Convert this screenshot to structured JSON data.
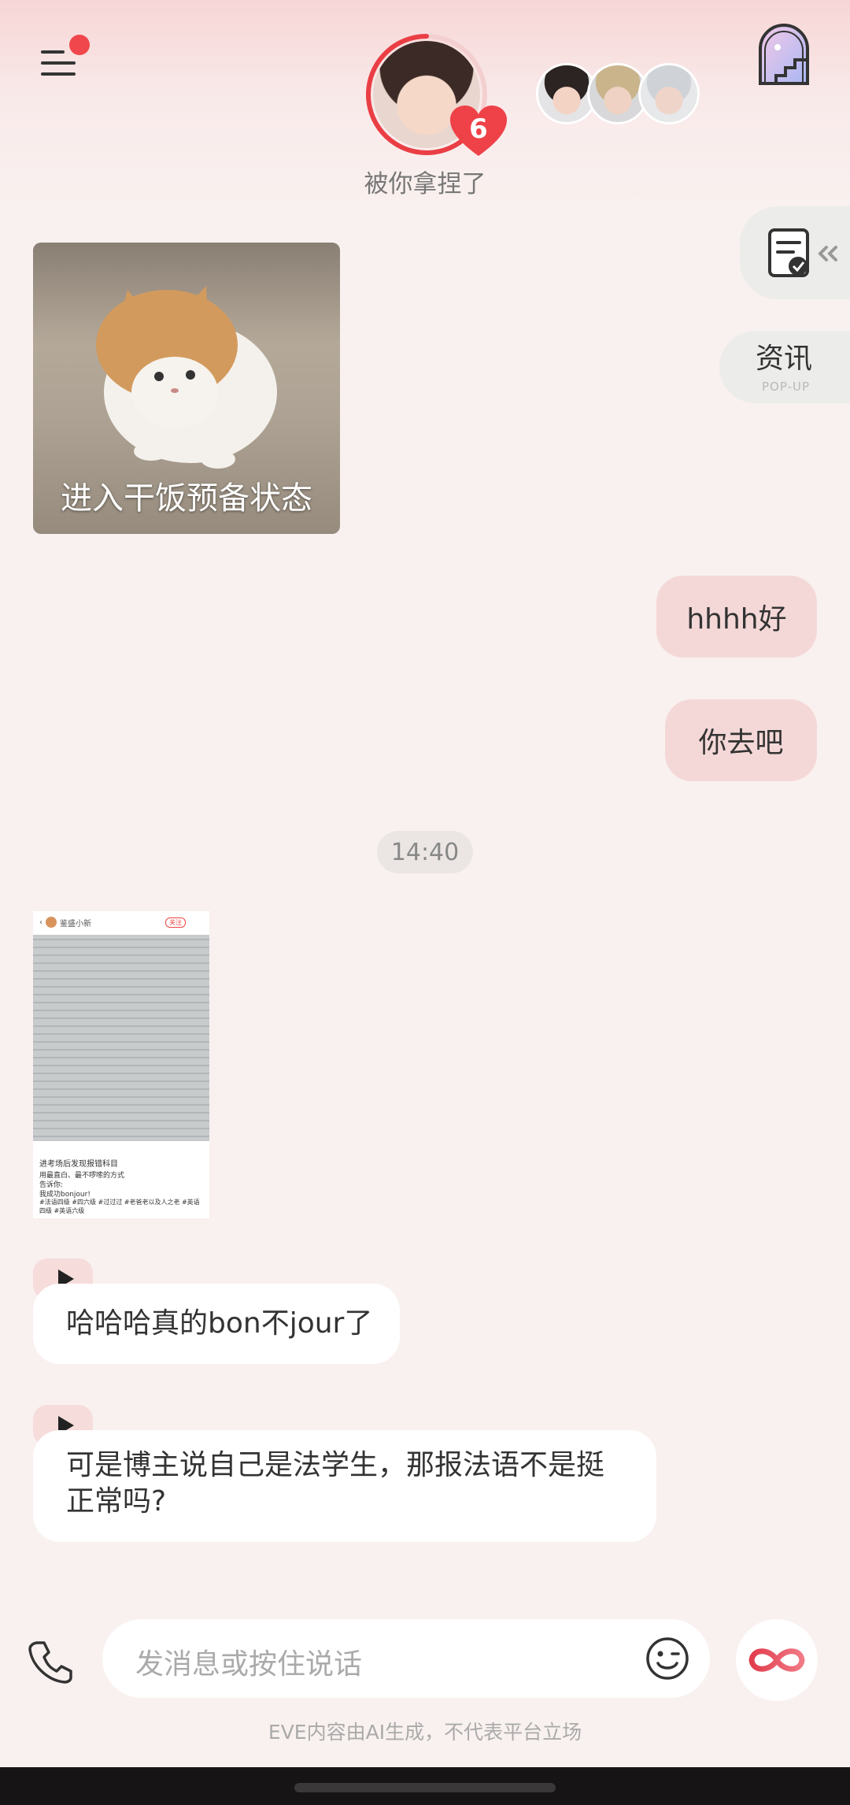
{
  "header": {
    "status_text": "被你拿捏了",
    "affection_level": "6",
    "menu_has_notification": true
  },
  "side_panel": {
    "news_label": "资讯",
    "news_sublabel": "POP-UP"
  },
  "messages": {
    "sticker_caption": "进入干饭预备状态",
    "out_1": "hhhh好",
    "out_2": "你去吧",
    "timestamp": "14:40",
    "shared_post": {
      "user": "鉴盛小新",
      "follow_label": "关注",
      "title": "进考场后发现报错科目",
      "line1": "用最直白、最不啰嗦的方式",
      "line2": "告诉你:",
      "line3": "我成功bonjour!",
      "tags": "#法语四级 #四六级 #过过过 #老爸老以及人之老 #英语四级 #英语六级"
    },
    "in_1": "哈哈哈真的bon不jour了",
    "in_2": "可是博主说自己是法学生，那报法语不是挺正常吗?"
  },
  "composer": {
    "placeholder": "发消息或按住说话"
  },
  "footer": {
    "disclaimer": "EVE内容由AI生成，不代表平台立场"
  },
  "colors": {
    "accent": "#f0474c",
    "bubble_out": "#f4d8d7",
    "background": "#f9f1ef"
  },
  "icons": [
    "menu-icon",
    "heart-icon",
    "window-stairs-icon",
    "checklist-icon",
    "chevron-left-icon",
    "play-icon",
    "phone-icon",
    "emoji-icon",
    "infinity-icon"
  ]
}
